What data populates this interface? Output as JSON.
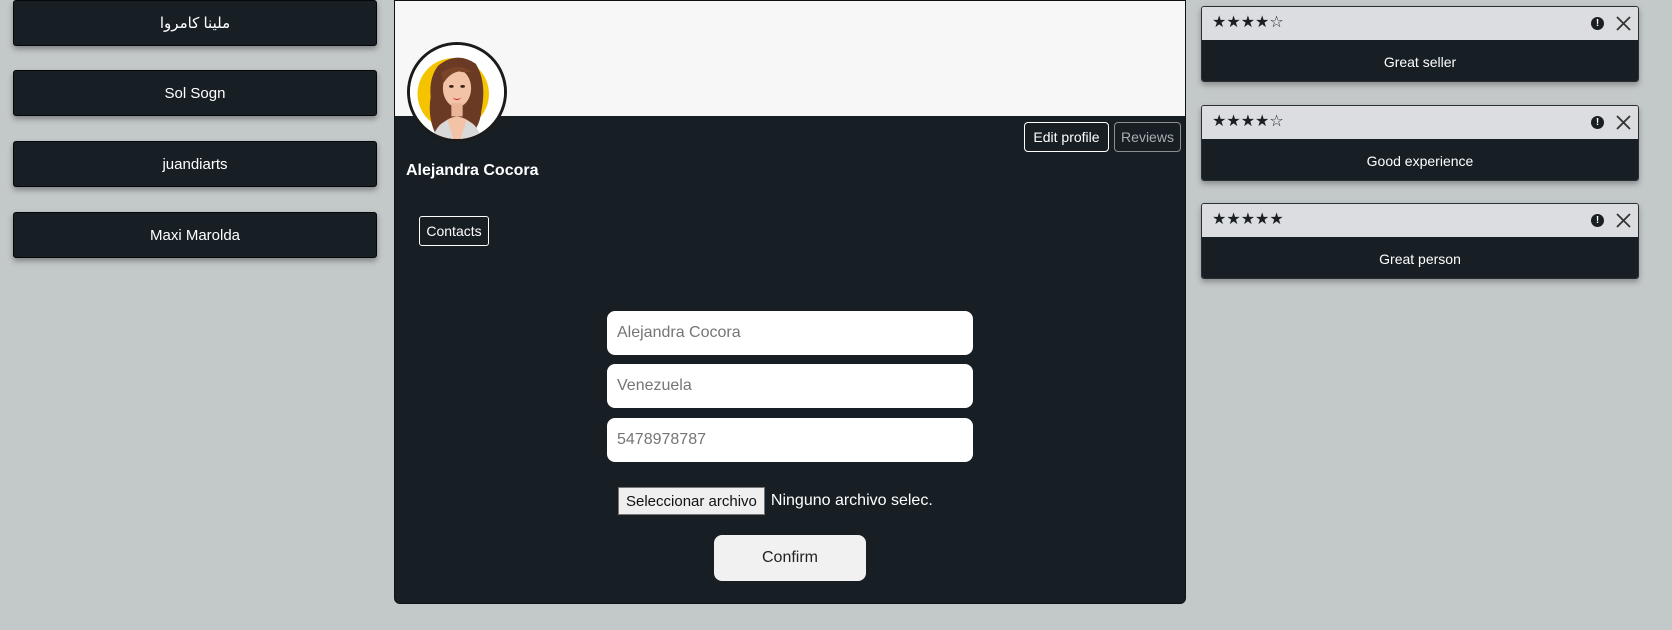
{
  "contacts": [
    {
      "name": "ملينا كامروا"
    },
    {
      "name": "Sol Sogn"
    },
    {
      "name": "juandiarts"
    },
    {
      "name": "Maxi Marolda"
    }
  ],
  "profile": {
    "name": "Alejandra Cocora",
    "edit_label": "Edit profile",
    "reviews_label": "Reviews",
    "contacts_label": "Contacts"
  },
  "form": {
    "name_placeholder": "Alejandra Cocora",
    "country_placeholder": "Venezuela",
    "phone_placeholder": "5478978787",
    "file_button_label": "Seleccionar archivo",
    "file_status": "Ninguno archivo selec.",
    "confirm_label": "Confirm"
  },
  "reviews": [
    {
      "rating": 4,
      "stars": "★★★★☆",
      "text": "Great seller"
    },
    {
      "rating": 4,
      "stars": "★★★★☆",
      "text": "Good experience"
    },
    {
      "rating": 5,
      "stars": "★★★★★",
      "text": "Great person"
    }
  ],
  "colors": {
    "page_bg": "#c3c8c8",
    "dark": "#171e24",
    "review_header": "#dcdde0",
    "avatar_accent": "#f5c400"
  }
}
